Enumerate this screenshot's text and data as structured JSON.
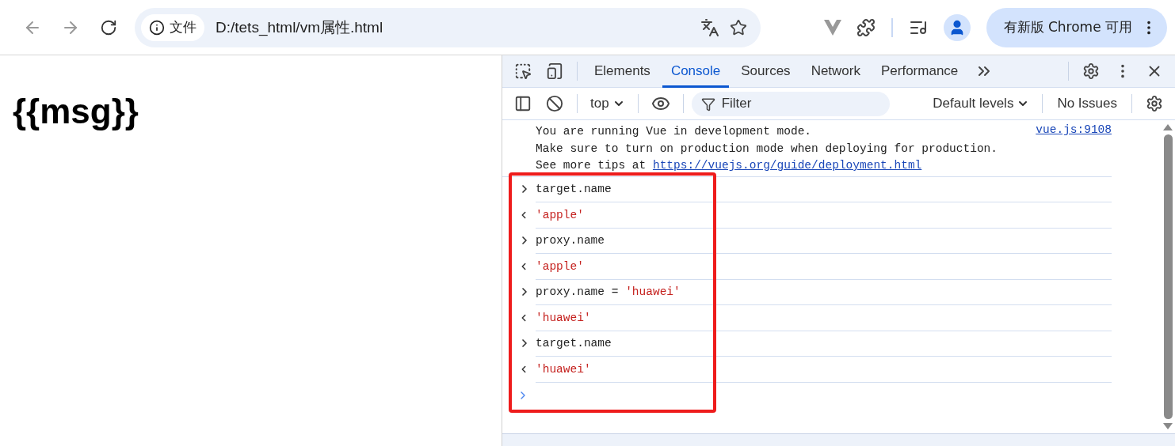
{
  "browser": {
    "address_chip": "文件",
    "url": "D:/tets_html/vm属性.html",
    "update_button": "有新版 Chrome 可用"
  },
  "page": {
    "heading": "{{msg}}"
  },
  "devtools": {
    "tabs": [
      {
        "label": "Elements",
        "selected": false
      },
      {
        "label": "Console",
        "selected": true
      },
      {
        "label": "Sources",
        "selected": false
      },
      {
        "label": "Network",
        "selected": false
      },
      {
        "label": "Performance",
        "selected": false
      }
    ],
    "context": "top",
    "filter_placeholder": "Filter",
    "levels": "Default levels",
    "issues": "No Issues",
    "message": {
      "lines": [
        "You are running Vue in development mode.",
        "Make sure to turn on production mode when deploying for production."
      ],
      "link_prefix": "See more tips at ",
      "link": "https://vuejs.org/guide/deployment.html",
      "source": "vue.js:9108"
    },
    "entries": [
      {
        "kind": "input",
        "parts": [
          {
            "kind": "code",
            "text": "target.name"
          }
        ]
      },
      {
        "kind": "output",
        "parts": [
          {
            "kind": "string",
            "text": "'apple'"
          }
        ]
      },
      {
        "kind": "input",
        "parts": [
          {
            "kind": "code",
            "text": "proxy.name"
          }
        ]
      },
      {
        "kind": "output",
        "parts": [
          {
            "kind": "string",
            "text": "'apple'"
          }
        ]
      },
      {
        "kind": "input",
        "parts": [
          {
            "kind": "code",
            "text": "proxy.name = "
          },
          {
            "kind": "string",
            "text": "'huawei'"
          }
        ]
      },
      {
        "kind": "output",
        "parts": [
          {
            "kind": "string",
            "text": "'huawei'"
          }
        ]
      },
      {
        "kind": "input",
        "parts": [
          {
            "kind": "code",
            "text": "target.name"
          }
        ]
      },
      {
        "kind": "output",
        "parts": [
          {
            "kind": "string",
            "text": "'huawei'"
          }
        ]
      }
    ]
  }
}
